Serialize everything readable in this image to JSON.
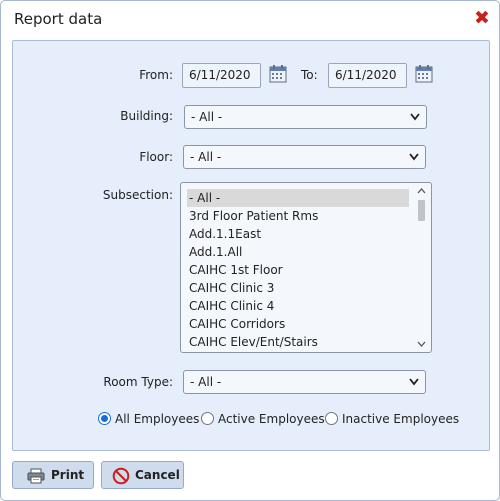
{
  "dialog": {
    "title": "Report data",
    "close_icon": "close-x-icon"
  },
  "colors": {
    "panel_bg": "#e5eefa",
    "accent": "#1a6fd6",
    "close": "#c8201c",
    "button_bg": "#cfdcee"
  },
  "dates": {
    "from_label": "From:",
    "from_value": "6/11/2020",
    "to_label": "To:",
    "to_value": "6/11/2020",
    "calendar_icon": "calendar-icon"
  },
  "building": {
    "label": "Building:",
    "selected": "- All -"
  },
  "floor": {
    "label": "Floor:",
    "selected": "- All -"
  },
  "subsection": {
    "label": "Subsection:",
    "items": [
      "- All -",
      "3rd Floor Patient Rms",
      "Add.1.1East",
      "Add.1.All",
      "CAIHC 1st Floor",
      "CAIHC Clinic 3",
      "CAIHC Clinic 4",
      "CAIHC Corridors",
      "CAIHC Elev/Ent/Stairs"
    ],
    "selected_index": 0
  },
  "room_type": {
    "label": "Room Type:",
    "selected": "- All -"
  },
  "employees": {
    "options": [
      "All Employees",
      "Active Employees",
      "Inactive Employees"
    ],
    "selected_index": 0
  },
  "buttons": {
    "print_label": "Print",
    "print_icon": "printer-icon",
    "cancel_label": "Cancel",
    "cancel_icon": "cancel-icon"
  }
}
